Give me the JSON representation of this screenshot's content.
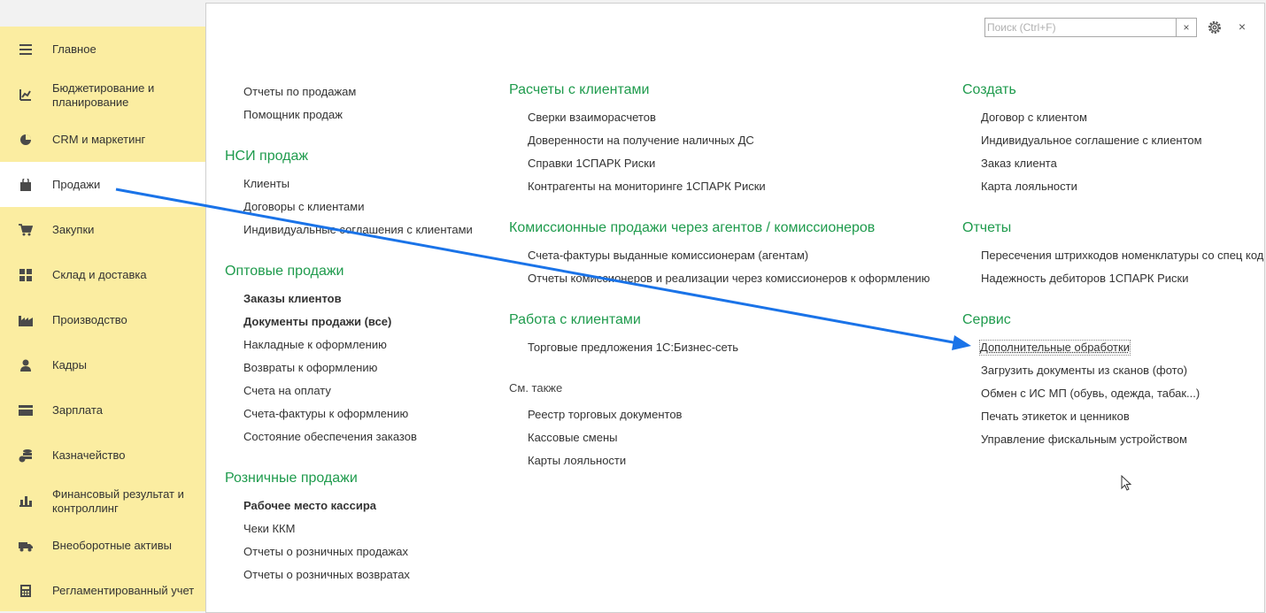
{
  "sidebar": {
    "items": [
      {
        "label": "Главное",
        "icon": "menu-lines-icon"
      },
      {
        "label": "Бюджетирование и планирование",
        "icon": "budget-chart-icon"
      },
      {
        "label": "CRM и маркетинг",
        "icon": "pie-chart-icon"
      },
      {
        "label": "Продажи",
        "icon": "shopping-bag-icon"
      },
      {
        "label": "Закупки",
        "icon": "shopping-cart-icon"
      },
      {
        "label": "Склад и доставка",
        "icon": "warehouse-grid-icon"
      },
      {
        "label": "Производство",
        "icon": "factory-icon"
      },
      {
        "label": "Кадры",
        "icon": "person-icon"
      },
      {
        "label": "Зарплата",
        "icon": "wallet-card-icon"
      },
      {
        "label": "Казначейство",
        "icon": "coins-stack-icon"
      },
      {
        "label": "Финансовый результат и контроллинг",
        "icon": "bar-chart-icon"
      },
      {
        "label": "Внеоборотные активы",
        "icon": "truck-icon"
      },
      {
        "label": "Регламентированный учет",
        "icon": "calculator-icon"
      }
    ],
    "active": "Продажи"
  },
  "search": {
    "placeholder": "Поиск (Ctrl+F)",
    "value": "",
    "clear": "×"
  },
  "toolbar": {
    "close": "×"
  },
  "col1": {
    "top_links": [
      "Отчеты по продажам",
      "Помощник продаж"
    ],
    "nsi": {
      "title": "НСИ продаж",
      "links": [
        "Клиенты",
        "Договоры с клиентами",
        "Индивидуальные соглашения с клиентами"
      ]
    },
    "wholesale": {
      "title": "Оптовые продажи",
      "links": [
        "Заказы клиентов",
        "Документы продажи (все)",
        "Накладные к оформлению",
        "Возвраты к оформлению",
        "Счета на оплату",
        "Счета-фактуры к оформлению",
        "Состояние обеспечения заказов"
      ]
    },
    "retail": {
      "title": "Розничные продажи",
      "links": [
        "Рабочее место кассира",
        "Чеки ККМ",
        "Отчеты о розничных продажах",
        "Отчеты о розничных возвратах"
      ]
    }
  },
  "col2": {
    "settlements": {
      "title": "Расчеты с клиентами",
      "links": [
        "Сверки взаиморасчетов",
        "Доверенности на получение наличных ДС",
        "Справки 1СПАРК Риски",
        "Контрагенты на мониторинге 1СПАРК Риски"
      ]
    },
    "commission": {
      "title": "Комиссионные продажи через агентов / комиссионеров",
      "links": [
        "Счета-фактуры выданные комиссионерам (агентам)",
        "Отчеты комиссионеров и реализации через комиссионеров к оформлению"
      ]
    },
    "clients_work": {
      "title": "Работа с клиентами",
      "links": [
        "Торговые предложения 1С:Бизнес-сеть"
      ]
    },
    "see_also": {
      "title": "См. также",
      "links": [
        "Реестр торговых документов",
        "Кассовые смены",
        "Карты лояльности"
      ]
    }
  },
  "col3": {
    "create": {
      "title": "Создать",
      "links": [
        "Договор с клиентом",
        "Индивидуальное соглашение с клиентом",
        "Заказ клиента",
        "Карта лояльности"
      ]
    },
    "reports": {
      "title": "Отчеты",
      "links": [
        "Пересечения штрихкодов номенклатуры со спец код",
        "Надежность дебиторов 1СПАРК Риски"
      ]
    },
    "service": {
      "title": "Сервис",
      "links": [
        "Дополнительные обработки",
        "Загрузить документы из сканов (фото)",
        "Обмен с ИС МП (обувь, одежда, табак...)",
        "Печать этикеток и ценников",
        "Управление фискальным устройством"
      ]
    }
  },
  "colors": {
    "sidebar_bg": "#fbeda1",
    "accent_green": "#1f9b4d",
    "arrow_blue": "#1a73e8"
  }
}
